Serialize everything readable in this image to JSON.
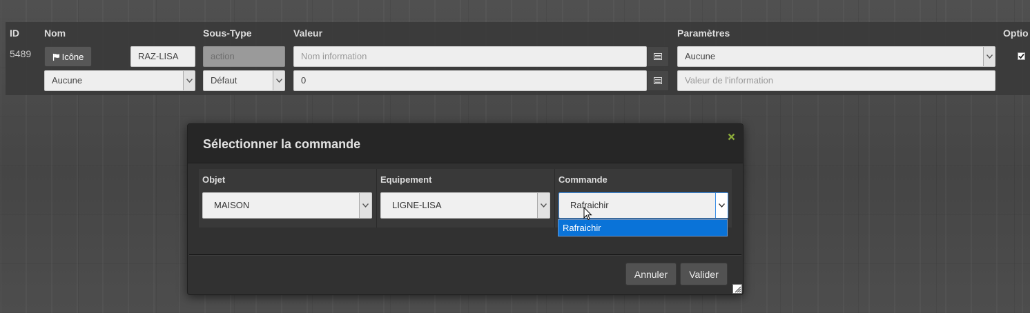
{
  "table": {
    "headers": {
      "id": "ID",
      "nom": "Nom",
      "sous_type": "Sous-Type",
      "valeur": "Valeur",
      "parametres": "Paramètres",
      "options": "Optio"
    },
    "row": {
      "id": "5489",
      "icon_button_label": "Icône",
      "name_value": "RAZ-LISA",
      "subtype_placeholder": "action",
      "valeur_placeholder": "Nom information",
      "parametres_value": "Aucune",
      "icon_select_value": "Aucune",
      "default_select_value": "Défaut",
      "valeur_value": "0",
      "info_value_placeholder": "Valeur de l'information",
      "option_checked": true
    }
  },
  "modal": {
    "title": "Sélectionner la commande",
    "columns": [
      "Objet",
      "Equipement",
      "Commande"
    ],
    "objet_value": "MAISON",
    "equipement_value": "LIGNE-LISA",
    "commande_value": "Rafraichir",
    "dropdown_options": [
      "Rafraichir"
    ],
    "cancel_label": "Annuler",
    "confirm_label": "Valider"
  },
  "colors": {
    "modal_bg": "#313131",
    "dropdown_highlight": "#0a73d8",
    "close_icon": "#8aa83a"
  }
}
